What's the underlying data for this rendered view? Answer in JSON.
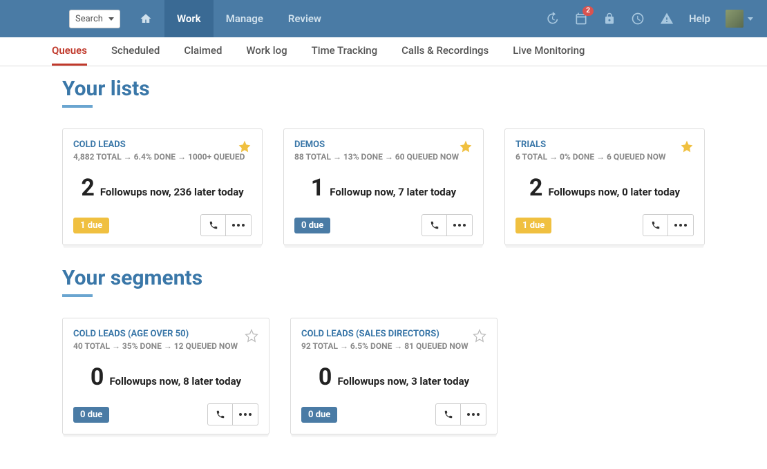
{
  "topbar": {
    "search_label": "Search",
    "nav": [
      {
        "type": "home",
        "label": ""
      },
      {
        "type": "text",
        "label": "Work",
        "active": true
      },
      {
        "type": "text",
        "label": "Manage"
      },
      {
        "type": "text",
        "label": "Review"
      }
    ],
    "calendar_badge": "2",
    "help_label": "Help"
  },
  "subnav": [
    {
      "label": "Queues",
      "active": true
    },
    {
      "label": "Scheduled"
    },
    {
      "label": "Claimed"
    },
    {
      "label": "Work log"
    },
    {
      "label": "Time Tracking"
    },
    {
      "label": "Calls & Recordings"
    },
    {
      "label": "Live Monitoring"
    }
  ],
  "sections": [
    {
      "title": "Your lists"
    },
    {
      "title": "Your segments"
    }
  ],
  "lists": [
    {
      "title": "COLD LEADS",
      "stats": "4,882 TOTAL → 6.4% DONE → 1000+ QUEUED",
      "starred": true,
      "big_number": "2",
      "followup_text": "Followups now, 236 later today",
      "due_label": "1 due",
      "due_color": "yellow"
    },
    {
      "title": "DEMOS",
      "stats": "88 TOTAL → 13% DONE → 60 QUEUED NOW",
      "starred": true,
      "big_number": "1",
      "followup_text": "Followup now, 7 later today",
      "due_label": "0 due",
      "due_color": "blue"
    },
    {
      "title": "TRIALS",
      "stats": "6 TOTAL → 0% DONE → 6 QUEUED NOW",
      "starred": true,
      "big_number": "2",
      "followup_text": "Followups now, 0 later today",
      "due_label": "1 due",
      "due_color": "yellow"
    }
  ],
  "segments": [
    {
      "title": "COLD LEADS (AGE OVER 50)",
      "stats": "40 TOTAL → 35% DONE → 12 QUEUED NOW",
      "starred": false,
      "big_number": "0",
      "followup_text": "Followups now, 8 later today",
      "due_label": "0 due",
      "due_color": "blue"
    },
    {
      "title": "COLD LEADS (SALES DIRECTORS)",
      "stats": "92 TOTAL → 6.5% DONE → 81 QUEUED NOW",
      "starred": false,
      "big_number": "0",
      "followup_text": "Followups now, 3 later today",
      "due_label": "0 due",
      "due_color": "blue"
    }
  ]
}
